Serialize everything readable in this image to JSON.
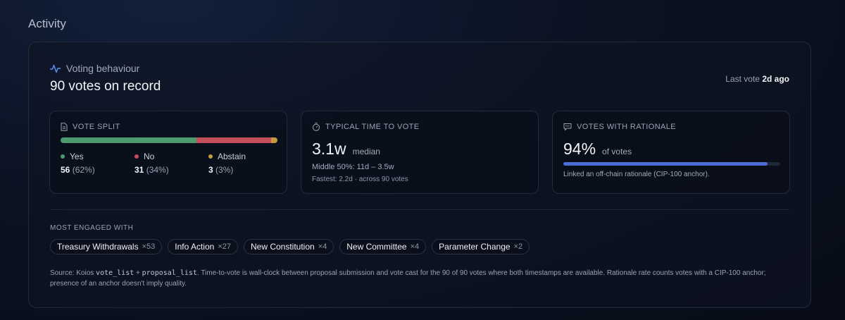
{
  "section": {
    "title": "Activity"
  },
  "header": {
    "kicker": "Voting behaviour",
    "title": "90 votes on record",
    "last_vote_label": "Last vote",
    "last_vote_value": "2d ago",
    "kicker_icon": "activity-pulse-icon"
  },
  "vote_split": {
    "label": "VOTE SPLIT",
    "icon": "document-icon",
    "items": [
      {
        "name": "Yes",
        "count": "56",
        "pct": "(62%)",
        "share": 62,
        "color": "#4e9b6f"
      },
      {
        "name": "No",
        "count": "31",
        "pct": "(34%)",
        "share": 34,
        "color": "#c44e5a"
      },
      {
        "name": "Abstain",
        "count": "3",
        "pct": "(3%)",
        "share": 3,
        "color": "#c49a3e"
      }
    ]
  },
  "time_to_vote": {
    "label": "TYPICAL TIME TO VOTE",
    "icon": "stopwatch-icon",
    "value": "3.1w",
    "unit": "median",
    "middle": "Middle 50%: 11d – 3.5w",
    "fastest": "Fastest: 2.2d · across 90 votes"
  },
  "rationale": {
    "label": "VOTES WITH RATIONALE",
    "icon": "message-icon",
    "value": "94%",
    "unit": "of votes",
    "fraction": 0.94,
    "note": "Linked an off-chain rationale (CIP-100 anchor)."
  },
  "engaged": {
    "label": "MOST ENGAGED WITH",
    "chips": [
      {
        "name": "Treasury Withdrawals",
        "count": "×53"
      },
      {
        "name": "Info Action",
        "count": "×27"
      },
      {
        "name": "New Constitution",
        "count": "×4"
      },
      {
        "name": "New Committee",
        "count": "×4"
      },
      {
        "name": "Parameter Change",
        "count": "×2"
      }
    ]
  },
  "source": {
    "prefix": "Source: Koios ",
    "code1": "vote_list",
    "plus": " + ",
    "code2": "proposal_list",
    "rest": ". Time-to-vote is wall-clock between proposal submission and vote cast for the 90 of 90 votes where both timestamps are available. Rationale rate counts votes with a CIP-100 anchor; presence of an anchor doesn't imply quality."
  }
}
